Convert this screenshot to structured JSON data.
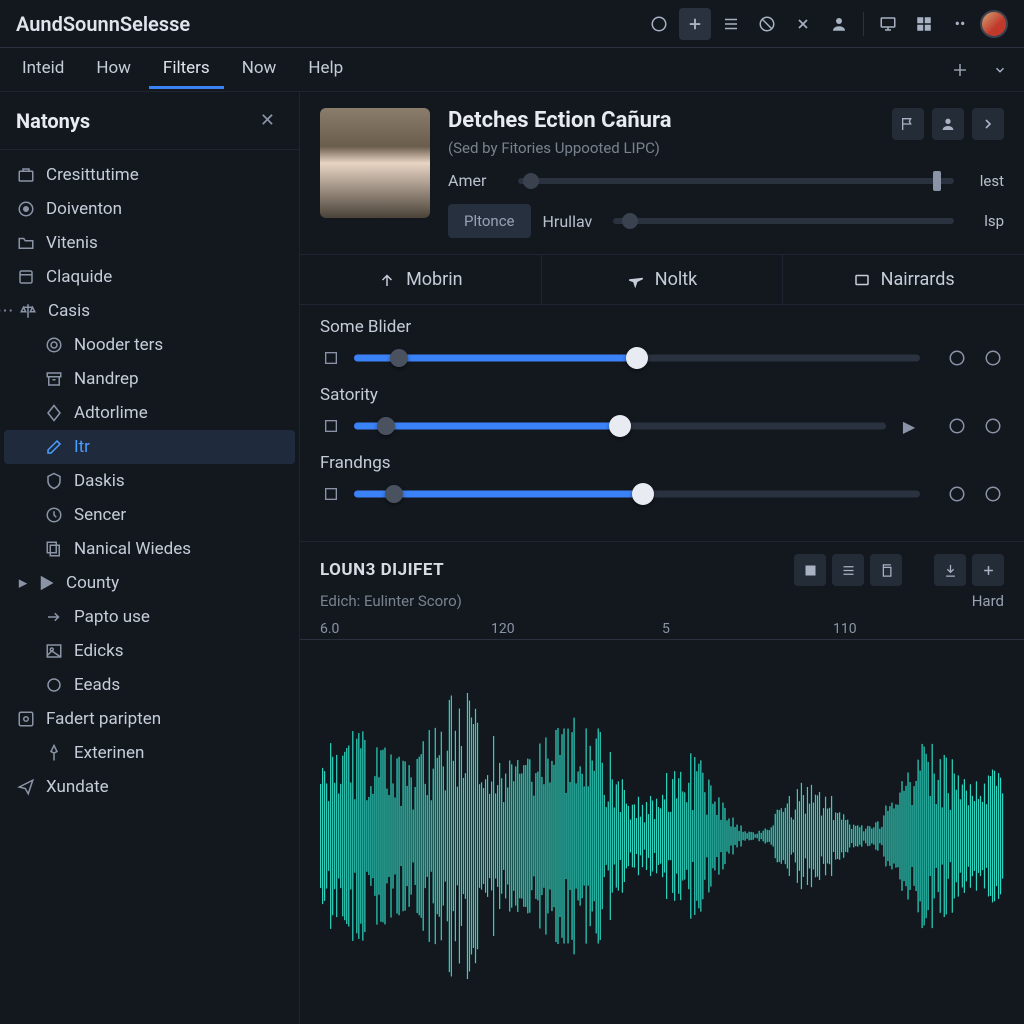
{
  "app_title": "AundSounnSelesse",
  "menubar": {
    "items": [
      "Inteid",
      "How",
      "Filters",
      "Now",
      "Help"
    ],
    "active_index": 2
  },
  "sidebar": {
    "title": "Natonys",
    "items": [
      {
        "icon": "briefcase",
        "label": "Cresittutime",
        "indent": 0
      },
      {
        "icon": "record",
        "label": "Doiventon",
        "indent": 0
      },
      {
        "icon": "folder",
        "label": "Vitenis",
        "indent": 0
      },
      {
        "icon": "box",
        "label": "Claquide",
        "indent": 0
      },
      {
        "icon": "scale",
        "label": "Casis",
        "indent": 0,
        "caret": true
      },
      {
        "icon": "target",
        "label": "Nooder ters",
        "indent": 1
      },
      {
        "icon": "archive",
        "label": "Nandrep",
        "indent": 1
      },
      {
        "icon": "diamond",
        "label": "Adtorlime",
        "indent": 1
      },
      {
        "icon": "edit",
        "label": "Itr",
        "indent": 1,
        "selected": true,
        "leftcaret": true
      },
      {
        "icon": "shield",
        "label": "Daskis",
        "indent": 1
      },
      {
        "icon": "clock",
        "label": "Sencer",
        "indent": 1
      },
      {
        "icon": "copy",
        "label": "Nanical Wiedes",
        "indent": 1
      },
      {
        "icon": "play",
        "label": "County",
        "indent": 0,
        "leftcaret": true
      },
      {
        "icon": "arrow-right",
        "label": "Papto use",
        "indent": 1
      },
      {
        "icon": "image",
        "label": "Edicks",
        "indent": 1
      },
      {
        "icon": "circle",
        "label": "Eeads",
        "indent": 1
      },
      {
        "icon": "dashboard",
        "label": "Fadert paripten",
        "indent": 0
      },
      {
        "icon": "pin",
        "label": "Exterinen",
        "indent": 1
      },
      {
        "icon": "send",
        "label": "Xundate",
        "indent": 0
      }
    ]
  },
  "profile": {
    "title": "Detches Ection Cañura",
    "subtitle": "(Sed by Fitories Uppooted LIPC)",
    "slider1": {
      "label": "Amer",
      "end": "lest",
      "fill": 96
    },
    "slider2": {
      "label": "Hrullav",
      "pill": "Pltonce",
      "end": "lsp",
      "fill": 10
    }
  },
  "tabs": [
    {
      "icon": "up-arrow",
      "label": "Mobrin"
    },
    {
      "icon": "plane",
      "label": "Noltk"
    },
    {
      "icon": "card",
      "label": "Nairrards"
    }
  ],
  "sliders": [
    {
      "label": "Some Blider",
      "start_icon": "grid",
      "thumb1": 8,
      "fill_to": 50,
      "thumb2": 50,
      "right_icons": [
        "close-circle",
        "at"
      ]
    },
    {
      "label": "Satority",
      "start_icon": "trash",
      "thumb1": 6,
      "fill_to": 50,
      "thumb2": 50,
      "right_icons": [
        "person",
        "redo"
      ],
      "extra_right": true
    },
    {
      "label": "Frandngs",
      "start_icon": "six",
      "thumb1": 7,
      "fill_to": 51,
      "thumb2": 51,
      "right_icons": [
        "tag",
        "at"
      ]
    }
  ],
  "waveform": {
    "title": "LOUN3 DIJIFET",
    "subtitle": "Edich: Eulinter Scoro)",
    "hard": "Hard",
    "ruler": [
      "6.0",
      "120",
      "5",
      "110"
    ]
  }
}
